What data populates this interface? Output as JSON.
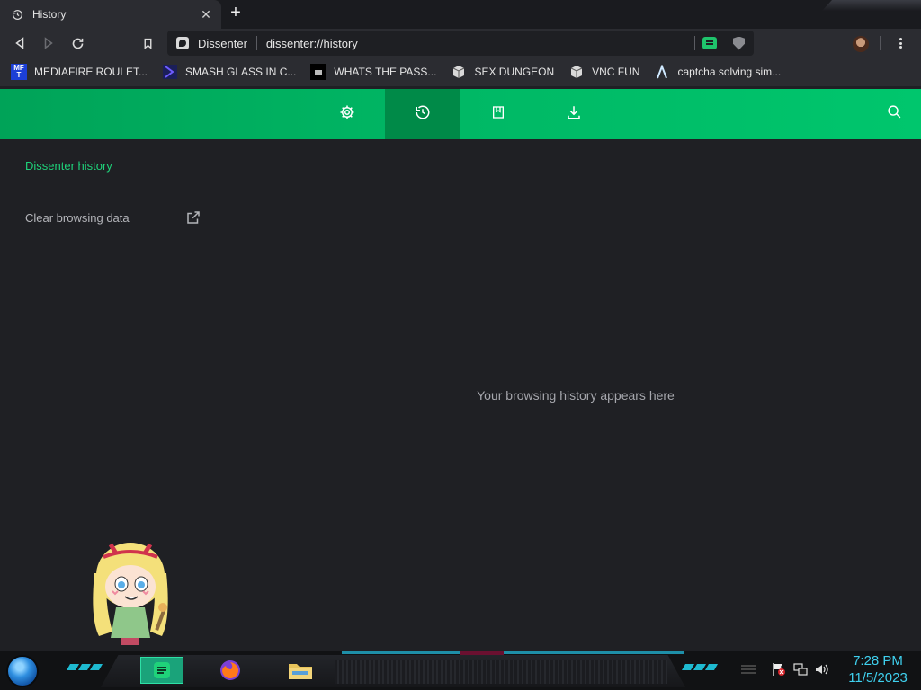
{
  "tab": {
    "title": "History",
    "close": "✕",
    "new_tab": "+"
  },
  "omnibox": {
    "site_name": "Dissenter",
    "url": "dissenter://history"
  },
  "bookmarks": [
    {
      "label": "MEDIAFIRE ROULET...",
      "icon": "mediafire-icon",
      "icon_text": "MF T"
    },
    {
      "label": "SMASH GLASS IN C...",
      "icon": "chevron-logo-icon"
    },
    {
      "label": "WHATS THE PASS...",
      "icon": "dark-site-icon"
    },
    {
      "label": "SEX DUNGEON",
      "icon": "cube-icon"
    },
    {
      "label": "VNC FUN",
      "icon": "cube-icon"
    },
    {
      "label": "captcha solving sim...",
      "icon": "lambda-icon"
    }
  ],
  "nav": {
    "items": [
      "settings-icon",
      "history-icon",
      "bookmarks-icon",
      "downloads-icon"
    ],
    "active": "history-icon",
    "search": "search-icon"
  },
  "sidebar": {
    "title": "Dissenter history",
    "clear_link": "Clear browsing data"
  },
  "main": {
    "empty_message": "Your browsing history appears here"
  },
  "taskbar": {
    "time": "7:28 PM",
    "date": "11/5/2023",
    "apps": [
      "dissenter-app-icon",
      "firefox-icon",
      "file-explorer-icon"
    ]
  },
  "colors": {
    "accent": "#00b865",
    "accent_active": "#008a48",
    "sidebar_title": "#1fd27a",
    "background": "#1f2024",
    "clock": "#3fd0ee"
  }
}
